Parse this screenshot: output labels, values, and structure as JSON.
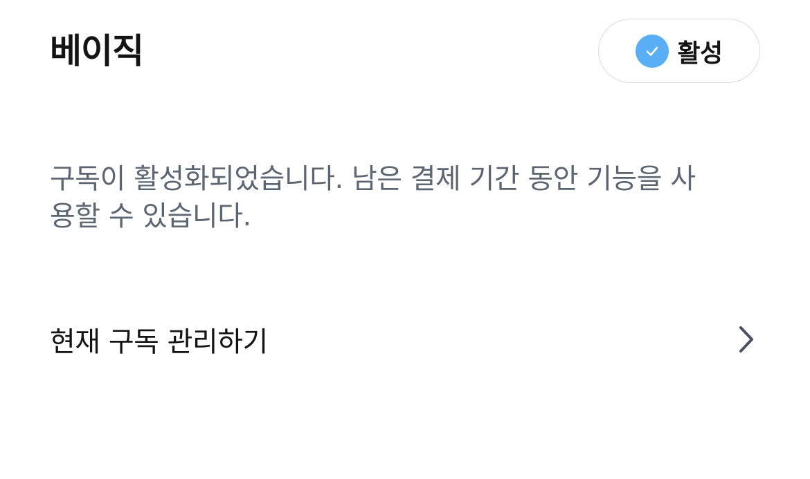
{
  "plan": {
    "name": "베이직"
  },
  "status": {
    "label": "활성",
    "icon": "check-circle-icon",
    "badge_color": "#5aaef5"
  },
  "description": "구독이 활성화되었습니다. 남은 결제 기간 동안 기능을 사용할 수 있습니다.",
  "manage": {
    "label": "현재 구독 관리하기",
    "icon": "chevron-right-icon"
  },
  "colors": {
    "title_text": "#141414",
    "body_text": "#5c6672",
    "pill_border": "#dcdcdc"
  }
}
